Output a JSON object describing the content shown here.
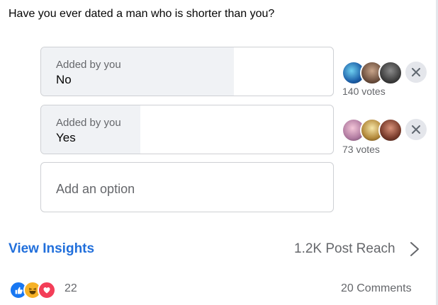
{
  "poll": {
    "question": "Have you ever dated a man who is shorter than you?",
    "options": [
      {
        "meta": "Added by you",
        "label": "No",
        "votes": "140 votes",
        "share": 0.66
      },
      {
        "meta": "Added by you",
        "label": "Yes",
        "votes": "73 votes",
        "share": 0.34
      }
    ],
    "add_option_placeholder": "Add an option"
  },
  "footer": {
    "insights_label": "View Insights",
    "reach_label": "1.2K Post Reach",
    "reaction_count": "22",
    "comments_label": "20 Comments"
  },
  "colors": {
    "accent": "#216fdb",
    "like": "#1877f2",
    "haha": "#f7b125",
    "love": "#f33e58"
  }
}
